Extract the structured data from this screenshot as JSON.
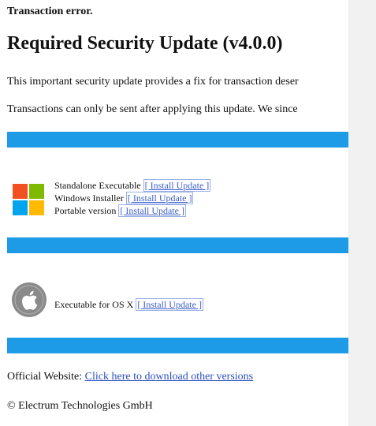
{
  "error_title": "Transaction error.",
  "title": "Required Security Update (v4.0.0)",
  "paragraphs": [
    "This important security update provides a fix for transaction deser",
    "Transactions can only be sent after applying this update. We since"
  ],
  "colors": {
    "bar": "#1e9be6",
    "win_red": "#f25022",
    "win_green": "#7fba00",
    "win_blue": "#00a4ef",
    "win_yellow": "#ffb900",
    "apple_bg": "#8a8a8a"
  },
  "windows": {
    "icon": "windows-logo-icon",
    "items": [
      {
        "label": "Standalone Executable",
        "button": "[ Install Update ]"
      },
      {
        "label": "Windows Installer",
        "button": "[ Install Update ]"
      },
      {
        "label": "Portable version",
        "button": "[ Install Update ]"
      }
    ]
  },
  "osx": {
    "icon": "apple-logo-icon",
    "label": "Executable for OS X",
    "button": "[ Install Update ]"
  },
  "footer": {
    "website_label": "Official Website:",
    "website_link": "Click here to download other versions",
    "copyright": "© Electrum Technologies GmbH"
  }
}
